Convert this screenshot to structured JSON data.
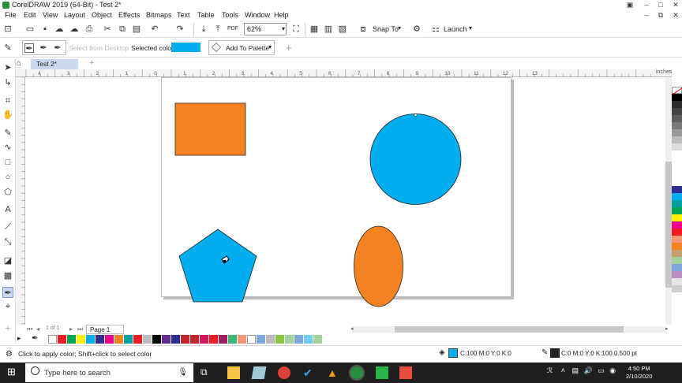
{
  "window": {
    "title": "CorelDRAW 2019 (64-Bit) - Test 2*"
  },
  "menu": [
    "File",
    "Edit",
    "View",
    "Layout",
    "Object",
    "Effects",
    "Bitmaps",
    "Text",
    "Table",
    "Tools",
    "Window",
    "Help"
  ],
  "toolbar": {
    "zoom_value": "62%",
    "snap_to_label": "Snap To",
    "launch_label": "Launch"
  },
  "property_bar": {
    "select_from_desktop": "Select from Desktop",
    "selected_color_label": "Selected color",
    "selected_color": "#00adef",
    "add_to_palette": "Add To Palette"
  },
  "doc_tab": {
    "label": "Test 2*"
  },
  "ruler": {
    "unit": "inches",
    "ticks": [
      "4",
      "3",
      "2",
      "1",
      "0",
      "1",
      "2",
      "3",
      "4",
      "5",
      "6",
      "7",
      "8",
      "9",
      "10",
      "11",
      "12",
      "13"
    ]
  },
  "page_nav": {
    "page_info": "1 of 1",
    "page_tab": "Page 1"
  },
  "status": {
    "hint": "Click to apply color; Shift+click to select color",
    "fill_readout": "C:100 M:0 Y:0 K:0",
    "outline_readout": "C:0 M:0 Y:0 K:100  0.500 pt"
  },
  "taskbar": {
    "search_placeholder": "Type here to search",
    "time": "4:50 PM",
    "date": "2/10/2020"
  },
  "colors": {
    "cyan_fill": "#00adef",
    "orange_fill": "#f58220",
    "outline": "#222222"
  },
  "shapes": [
    {
      "kind": "rectangle",
      "fill": "#f58220"
    },
    {
      "kind": "circle",
      "fill": "#00adef"
    },
    {
      "kind": "pentagon",
      "fill": "#00adef"
    },
    {
      "kind": "ellipse",
      "fill": "#f58220"
    }
  ]
}
